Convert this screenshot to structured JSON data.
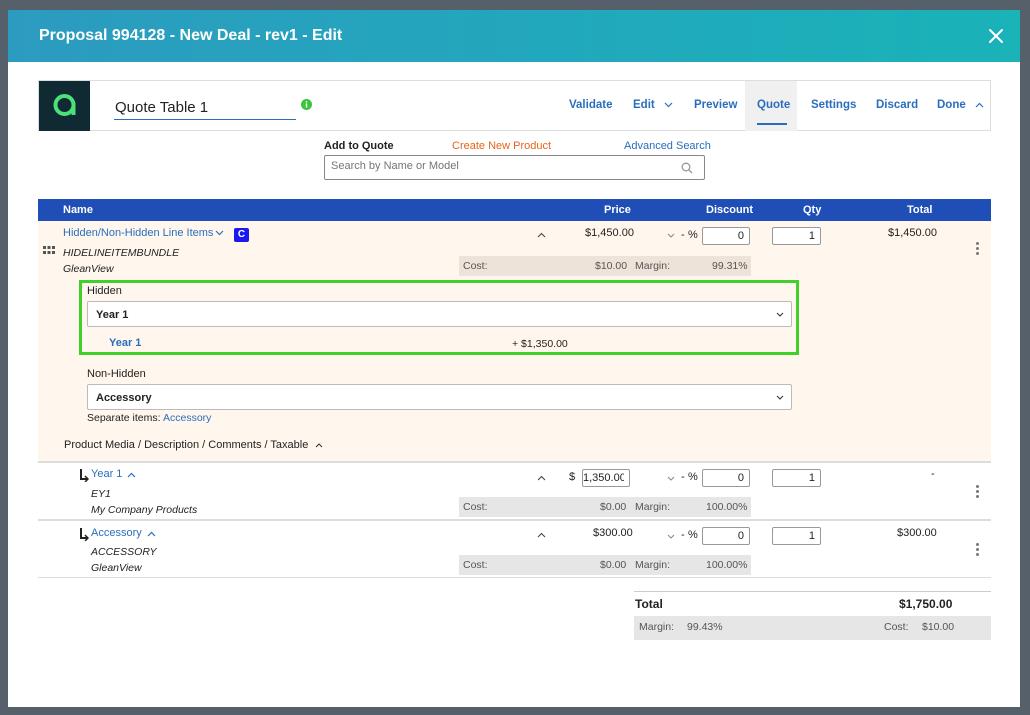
{
  "modal": {
    "title": "Proposal 994128 - New Deal - rev1 - Edit"
  },
  "toolbar": {
    "table_name": "Quote Table 1",
    "items": {
      "validate": "Validate",
      "edit": "Edit",
      "preview": "Preview",
      "quote": "Quote",
      "settings": "Settings",
      "discard": "Discard",
      "done": "Done"
    }
  },
  "add_to_quote": {
    "label": "Add to Quote",
    "create_link": "Create New Product",
    "advanced_link": "Advanced Search",
    "search_placeholder": "Search by Name or Model"
  },
  "table_header": {
    "name": "Name",
    "price": "Price",
    "discount": "Discount",
    "qty": "Qty",
    "total": "Total"
  },
  "bundle": {
    "name": "Hidden/Non-Hidden Line Items",
    "badge": "C",
    "model": "HIDELINEITEMBUNDLE",
    "vendor": "GleanView",
    "price": "$1,450.00",
    "discount_symbol": "%",
    "discount_dash": "-",
    "discount_value": "0",
    "qty": "1",
    "total": "$1,450.00",
    "cost_label": "Cost:",
    "cost": "$10.00",
    "margin_label": "Margin:",
    "margin": "99.31%",
    "hidden_group": {
      "label": "Hidden",
      "selected": "Year 1",
      "option_link": "Year 1",
      "option_price": "+ $1,350.00"
    },
    "nonhidden_group": {
      "label": "Non-Hidden",
      "selected": "Accessory",
      "separate_label": "Separate items:",
      "separate_link": "Accessory"
    },
    "media_link": "Product Media / Description / Comments / Taxable"
  },
  "child_rows": [
    {
      "name": "Year 1",
      "model": "EY1",
      "vendor": "My Company Products",
      "currency": "$",
      "price": "1,350.00",
      "discount_dash": "-",
      "discount_symbol": "%",
      "discount_value": "0",
      "qty": "1",
      "total": "-",
      "cost_label": "Cost:",
      "cost": "$0.00",
      "margin_label": "Margin:",
      "margin": "100.00%"
    },
    {
      "name": "Accessory",
      "model": "ACCESSORY",
      "vendor": "GleanView",
      "price": "$300.00",
      "discount_dash": "-",
      "discount_symbol": "%",
      "discount_value": "0",
      "qty": "1",
      "total": "$300.00",
      "cost_label": "Cost:",
      "cost": "$0.00",
      "margin_label": "Margin:",
      "margin": "100.00%"
    }
  ],
  "footer": {
    "total_label": "Total",
    "total_value": "$1,750.00",
    "margin_label": "Margin:",
    "margin_value": "99.43%",
    "cost_label": "Cost:",
    "cost_value": "$10.00"
  },
  "colors": {
    "header_start": "#2c9bc0",
    "header_end": "#19b3b8",
    "table_header": "#1f4fb6",
    "highlight": "#3fd12a",
    "link": "#2a6ebb",
    "orange": "#e8631a"
  }
}
